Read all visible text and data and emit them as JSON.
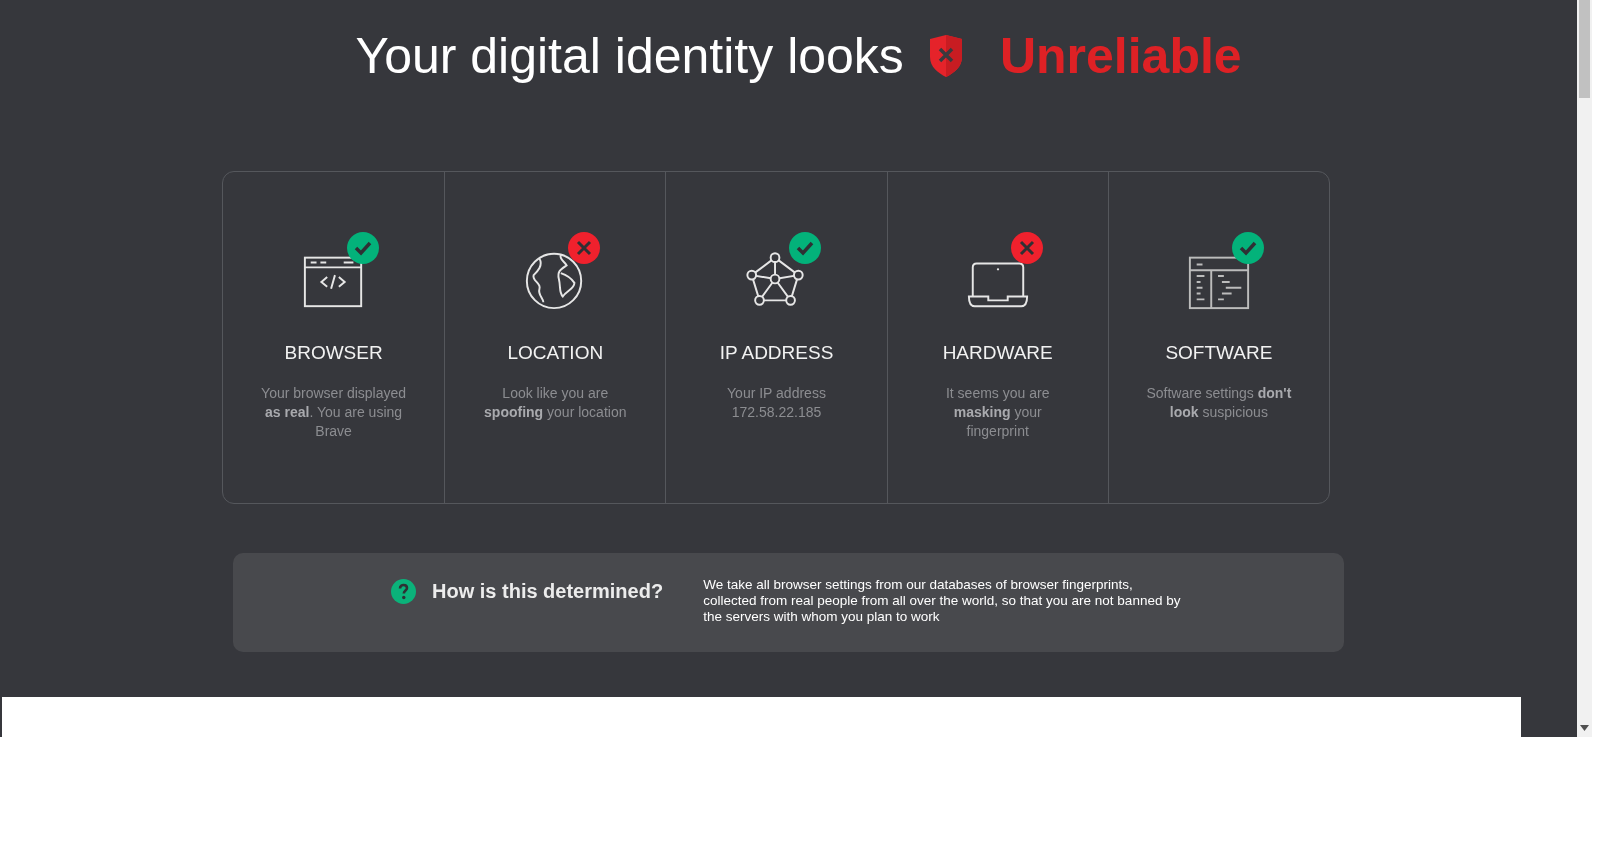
{
  "headline": {
    "text": "Your digital identity looks",
    "verdict": "Unreliable"
  },
  "checks": [
    {
      "kind": "browser",
      "title": "BROWSER",
      "passed": true,
      "description": "Your browser displayed **as real**. You are using Brave"
    },
    {
      "kind": "location",
      "title": "LOCATION",
      "passed": false,
      "description": "Look like you are **spoofing** your location"
    },
    {
      "kind": "ip",
      "title": "IP ADDRESS",
      "passed": true,
      "description": "Your IP address 172.58.22.185"
    },
    {
      "kind": "hardware",
      "title": "HARDWARE",
      "passed": false,
      "description": "It seems you are **masking** your fingerprint"
    },
    {
      "kind": "software",
      "title": "SOFTWARE",
      "passed": true,
      "description": "Software settings **don't look** suspicious"
    }
  ],
  "info": {
    "question": "How is this determined?",
    "answer": "We take all browser settings from our databases of browser fingerprints, collected from real people from all over the world, so that you are not banned by the servers with whom you plan to work"
  }
}
